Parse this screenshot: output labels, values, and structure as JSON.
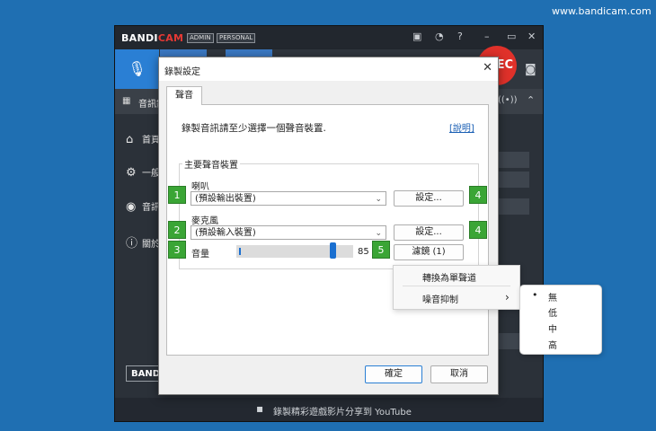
{
  "watermark": "www.bandicam.com",
  "main_window": {
    "logo_a": "BANDI",
    "logo_b": "CAM",
    "badges": [
      "ADMIN",
      "PERSONAL"
    ],
    "tabbar_label": "音訊錄",
    "rec_label": "EC",
    "sidebar": [
      {
        "icon": "home-icon",
        "glyph": "⌂",
        "label": "首頁"
      },
      {
        "icon": "gear-icon",
        "glyph": "⚙",
        "label": "一般"
      },
      {
        "icon": "audio-icon",
        "glyph": "◉",
        "label": "音訊"
      },
      {
        "icon": "info-icon",
        "glyph": "ⓘ",
        "label": "關於"
      }
    ],
    "bottom_button": "BANDI",
    "footer_text": "錄製精彩遊戲影片分享到 YouTube"
  },
  "dialog": {
    "title": "錄製設定",
    "tab": "聲音",
    "instruction": "錄製音訊請至少選擇一個聲音裝置.",
    "help_link": "[說明]",
    "group_title": "主要聲音裝置",
    "speaker": {
      "label": "喇叭",
      "value": "(預設輸出裝置)",
      "settings_button": "設定..."
    },
    "microphone": {
      "label": "麥克風",
      "value": "(預設輸入裝置)",
      "settings_button": "設定..."
    },
    "volume": {
      "label": "音量",
      "value": "85",
      "level_percent": 85
    },
    "filter_button": "濾鏡 (1)",
    "ok_button": "確定",
    "cancel_button": "取消"
  },
  "context_menu": {
    "items": [
      "轉換為單聲道",
      "噪音抑制"
    ],
    "submenu_arrow": "›"
  },
  "submenu": {
    "selected_bullet": "•",
    "items": [
      "無",
      "低",
      "中",
      "高"
    ],
    "selected": "無"
  },
  "markers": [
    "1",
    "2",
    "3",
    "4",
    "4",
    "5"
  ],
  "colors": {
    "accent": "#2a7fd4",
    "marker_green": "#3aa535",
    "rec_red": "#e0312a",
    "desktop": "#1f6fb2"
  }
}
